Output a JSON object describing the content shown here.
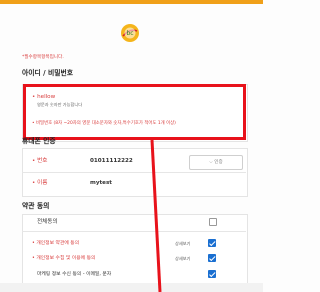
{
  "brand": {
    "logo_text": "bc"
  },
  "required_note": "*필수항목항목입니다.",
  "sections": {
    "id_password": "아이디 / 비밀번호",
    "phone_verify": "휴대폰 인증",
    "agree": "약관 동의"
  },
  "account": {
    "id_label": "• hellow",
    "id_hint": "영문과 숫자만 가능합니다",
    "pw_label": "• 비밀번호 (8자 ~20자의 영문 대소문자와 숫자,특수기호가 적어도 1개 이상)"
  },
  "phone": {
    "number_label": "• 번호",
    "number_value": "01011112222",
    "verify_button": "인증",
    "name_label": "• 이름",
    "name_value": "mytest"
  },
  "terms": {
    "all_label": "전체동의",
    "items": [
      {
        "label": "• 개인정보 약관에 동의",
        "link": "상세보기"
      },
      {
        "label": "• 개인정보 수집 및 이용에 동의",
        "link": "상세보기"
      },
      {
        "label": "마케팅 정보 수신 동의 - 이메일, 문자"
      }
    ]
  },
  "colors": {
    "accent": "#f0a019",
    "highlight": "#e8121b",
    "check": "#1a6fd1"
  }
}
